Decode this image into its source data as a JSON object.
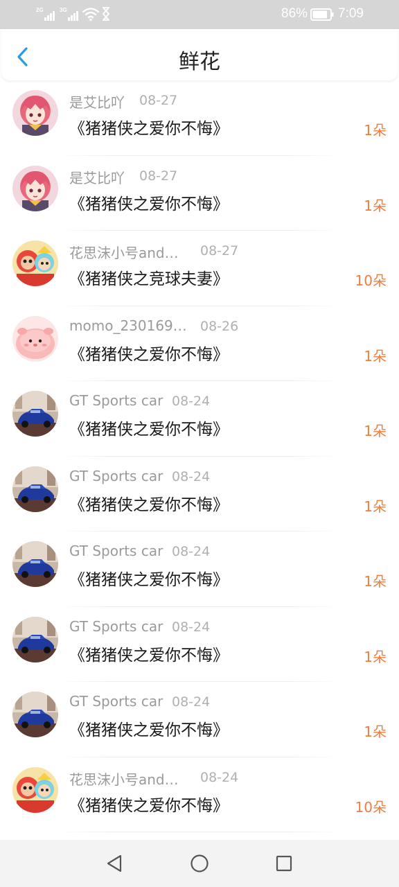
{
  "status_bar": {
    "sim1": "2G",
    "sim2": "3G",
    "battery_percent": "86%",
    "battery_level": 0.86,
    "time": "7:09",
    "icons": [
      "signal-icon",
      "signal-icon",
      "wifi-icon",
      "hourglass-icon",
      "battery-icon"
    ]
  },
  "header": {
    "title": "鲜花",
    "back_icon": "chevron-left-icon",
    "accent_color": "#2a9be2"
  },
  "list": [
    {
      "user": "是艾比吖",
      "date": "08-27",
      "title": "《猪猪侠之爱你不悔》",
      "count": "1朵",
      "avatar": "anime-girl"
    },
    {
      "user": "是艾比吖",
      "date": "08-27",
      "title": "《猪猪侠之爱你不悔》",
      "count": "1朵",
      "avatar": "anime-girl"
    },
    {
      "user": "花思沫小号and…",
      "date": "08-27",
      "title": "《猪猪侠之竞球夫妻》",
      "count": "10朵",
      "avatar": "cartoon-pig"
    },
    {
      "user": "momo_230169…",
      "date": "08-26",
      "title": "《猪猪侠之爱你不悔》",
      "count": "1朵",
      "avatar": "pink-blob"
    },
    {
      "user": "GT Sports car",
      "date": "08-24",
      "title": "《猪猪侠之爱你不悔》",
      "count": "1朵",
      "avatar": "blue-car"
    },
    {
      "user": "GT Sports car",
      "date": "08-24",
      "title": "《猪猪侠之爱你不悔》",
      "count": "1朵",
      "avatar": "blue-car"
    },
    {
      "user": "GT Sports car",
      "date": "08-24",
      "title": "《猪猪侠之爱你不悔》",
      "count": "1朵",
      "avatar": "blue-car"
    },
    {
      "user": "GT Sports car",
      "date": "08-24",
      "title": "《猪猪侠之爱你不悔》",
      "count": "1朵",
      "avatar": "blue-car"
    },
    {
      "user": "GT Sports car",
      "date": "08-24",
      "title": "《猪猪侠之爱你不悔》",
      "count": "1朵",
      "avatar": "blue-car"
    },
    {
      "user": "花思沫小号and…",
      "date": "08-24",
      "title": "《猪猪侠之爱你不悔》",
      "count": "10朵",
      "avatar": "cartoon-pig"
    }
  ],
  "colors": {
    "count": "#f07d3e",
    "name": "#9a9a9a",
    "date": "#b0b0b0",
    "title_text": "#1a1a1a"
  },
  "nav_bar": {
    "icons": [
      "back-triangle-icon",
      "home-circle-icon",
      "recents-square-icon"
    ]
  }
}
